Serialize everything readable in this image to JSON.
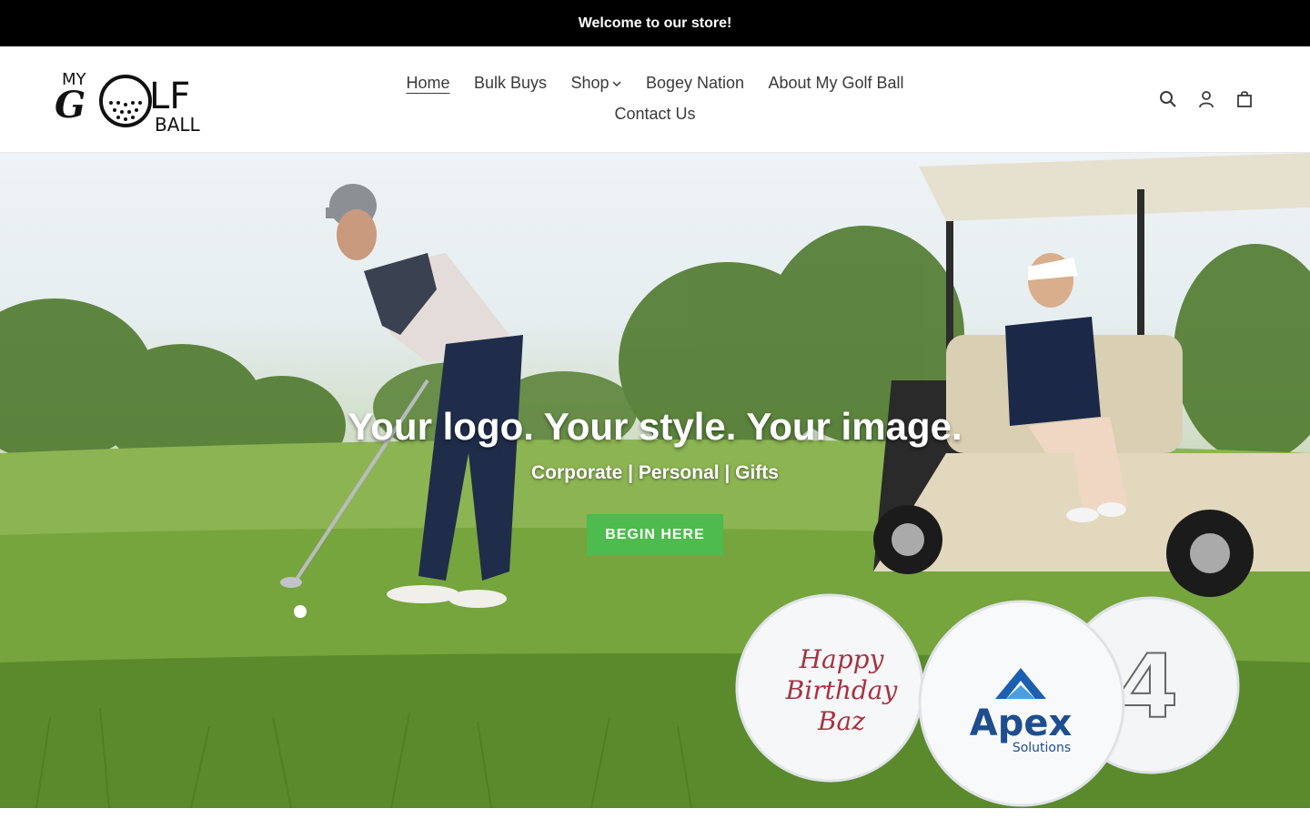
{
  "announcement": "Welcome to our store!",
  "logo": {
    "line1": "MY",
    "line2": "GOLF",
    "line3": "BALL"
  },
  "nav": {
    "items": [
      {
        "label": "Home"
      },
      {
        "label": "Bulk Buys"
      },
      {
        "label": "Shop"
      },
      {
        "label": "Bogey Nation"
      },
      {
        "label": "About My Golf Ball"
      },
      {
        "label": "Contact Us"
      }
    ]
  },
  "header_icons": [
    "search-icon",
    "account-icon",
    "cart-icon"
  ],
  "hero": {
    "title": "Your logo. Your style. Your image.",
    "subtitle": "Corporate | Personal | Gifts",
    "button_label": "BEGIN HERE",
    "button_color": "#4dbb4d",
    "balls": {
      "ball1_lines": [
        "Happy",
        "Birthday",
        "Baz"
      ],
      "ball2_brand": "Apex",
      "ball2_sub": "Solutions",
      "ball3_number": "4"
    }
  },
  "colors": {
    "announcement_bg": "#000000",
    "text": "#3a3a3a",
    "accent_green": "#4dbb4d"
  }
}
